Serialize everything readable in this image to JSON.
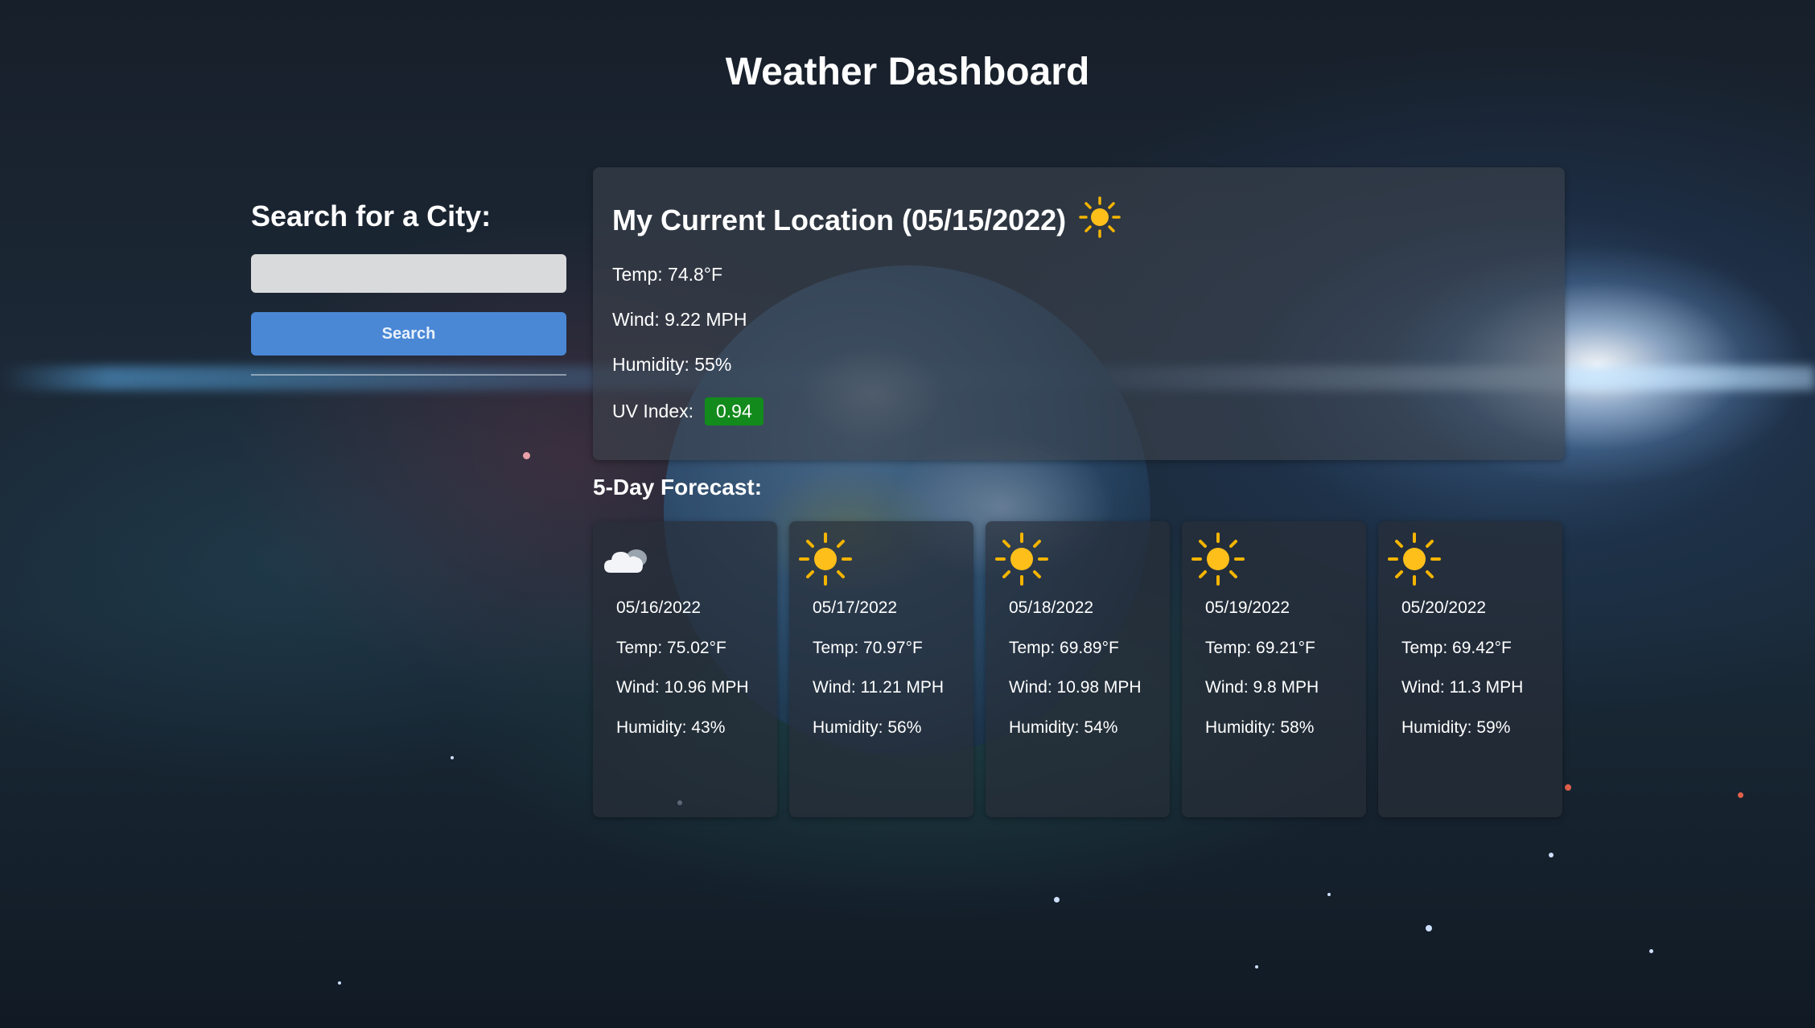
{
  "page": {
    "title": "Weather Dashboard"
  },
  "search": {
    "heading": "Search for a City:",
    "input_value": "",
    "button_label": "Search"
  },
  "current": {
    "title": "My Current Location (05/15/2022)",
    "icon": "sun-icon",
    "temp": "Temp: 74.8°F",
    "wind": "Wind: 9.22 MPH",
    "humidity": "Humidity: 55%",
    "uv_label": "UV Index:",
    "uv_value": "0.94",
    "uv_color": "#138a1c"
  },
  "forecast": {
    "heading": "5-Day Forecast:",
    "days": [
      {
        "icon": "cloud-icon",
        "date": "05/16/2022",
        "temp": "Temp: 75.02°F",
        "wind": "Wind: 10.96 MPH",
        "humidity": "Humidity: 43%"
      },
      {
        "icon": "sun-icon",
        "date": "05/17/2022",
        "temp": "Temp: 70.97°F",
        "wind": "Wind: 11.21 MPH",
        "humidity": "Humidity: 56%"
      },
      {
        "icon": "sun-icon",
        "date": "05/18/2022",
        "temp": "Temp: 69.89°F",
        "wind": "Wind: 10.98 MPH",
        "humidity": "Humidity: 54%"
      },
      {
        "icon": "sun-icon",
        "date": "05/19/2022",
        "temp": "Temp: 69.21°F",
        "wind": "Wind: 9.8 MPH",
        "humidity": "Humidity: 58%"
      },
      {
        "icon": "sun-icon",
        "date": "05/20/2022",
        "temp": "Temp: 69.42°F",
        "wind": "Wind: 11.3 MPH",
        "humidity": "Humidity: 59%"
      }
    ]
  }
}
